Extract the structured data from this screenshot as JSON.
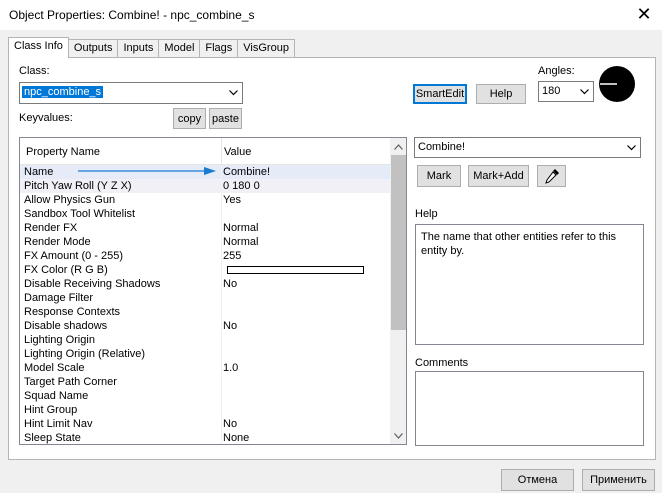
{
  "window": {
    "title": "Object Properties: Combine! - npc_combine_s",
    "close_glyph": "✕"
  },
  "tabs": [
    "Class Info",
    "Outputs",
    "Inputs",
    "Model",
    "Flags",
    "VisGroup"
  ],
  "class_section": {
    "label": "Class:",
    "value": "npc_combine_s"
  },
  "keyvalues": {
    "label": "Keyvalues:",
    "copy": "copy",
    "paste": "paste"
  },
  "smartedit_label": "SmartEdit",
  "help_button": "Help",
  "angles": {
    "label": "Angles:",
    "value": "180"
  },
  "grid": {
    "col_name": "Property Name",
    "col_value": "Value",
    "rows": [
      {
        "name": "Name",
        "value": "Combine!"
      },
      {
        "name": "Pitch Yaw Roll (Y Z X)",
        "value": "0 180 0"
      },
      {
        "name": "Allow Physics Gun",
        "value": "Yes"
      },
      {
        "name": "Sandbox Tool Whitelist",
        "value": ""
      },
      {
        "name": "Render FX",
        "value": "Normal"
      },
      {
        "name": "Render Mode",
        "value": "Normal"
      },
      {
        "name": "FX Amount (0 - 255)",
        "value": "255"
      },
      {
        "name": "FX Color (R G B)",
        "value": ""
      },
      {
        "name": "Disable Receiving Shadows",
        "value": "No"
      },
      {
        "name": "Damage Filter",
        "value": ""
      },
      {
        "name": "Response Contexts",
        "value": ""
      },
      {
        "name": "Disable shadows",
        "value": "No"
      },
      {
        "name": "Lighting Origin",
        "value": ""
      },
      {
        "name": "Lighting Origin (Relative)",
        "value": ""
      },
      {
        "name": "Model Scale",
        "value": "1.0"
      },
      {
        "name": "Target Path Corner",
        "value": ""
      },
      {
        "name": "Squad Name",
        "value": ""
      },
      {
        "name": "Hint Group",
        "value": ""
      },
      {
        "name": "Hint Limit Nav",
        "value": "No"
      },
      {
        "name": "Sleep State",
        "value": "None"
      }
    ]
  },
  "value_editor": {
    "value": "Combine!"
  },
  "mark_button": "Mark",
  "mark_add_button": "Mark+Add",
  "help_section": {
    "label": "Help",
    "text": "The name that other entities refer to this entity by."
  },
  "comments_section": {
    "label": "Comments",
    "text": ""
  },
  "footer": {
    "cancel": "Отмена",
    "apply": "Применить"
  },
  "colors": {
    "selection": "#0078d7",
    "arrow": "#1a7bd1"
  }
}
